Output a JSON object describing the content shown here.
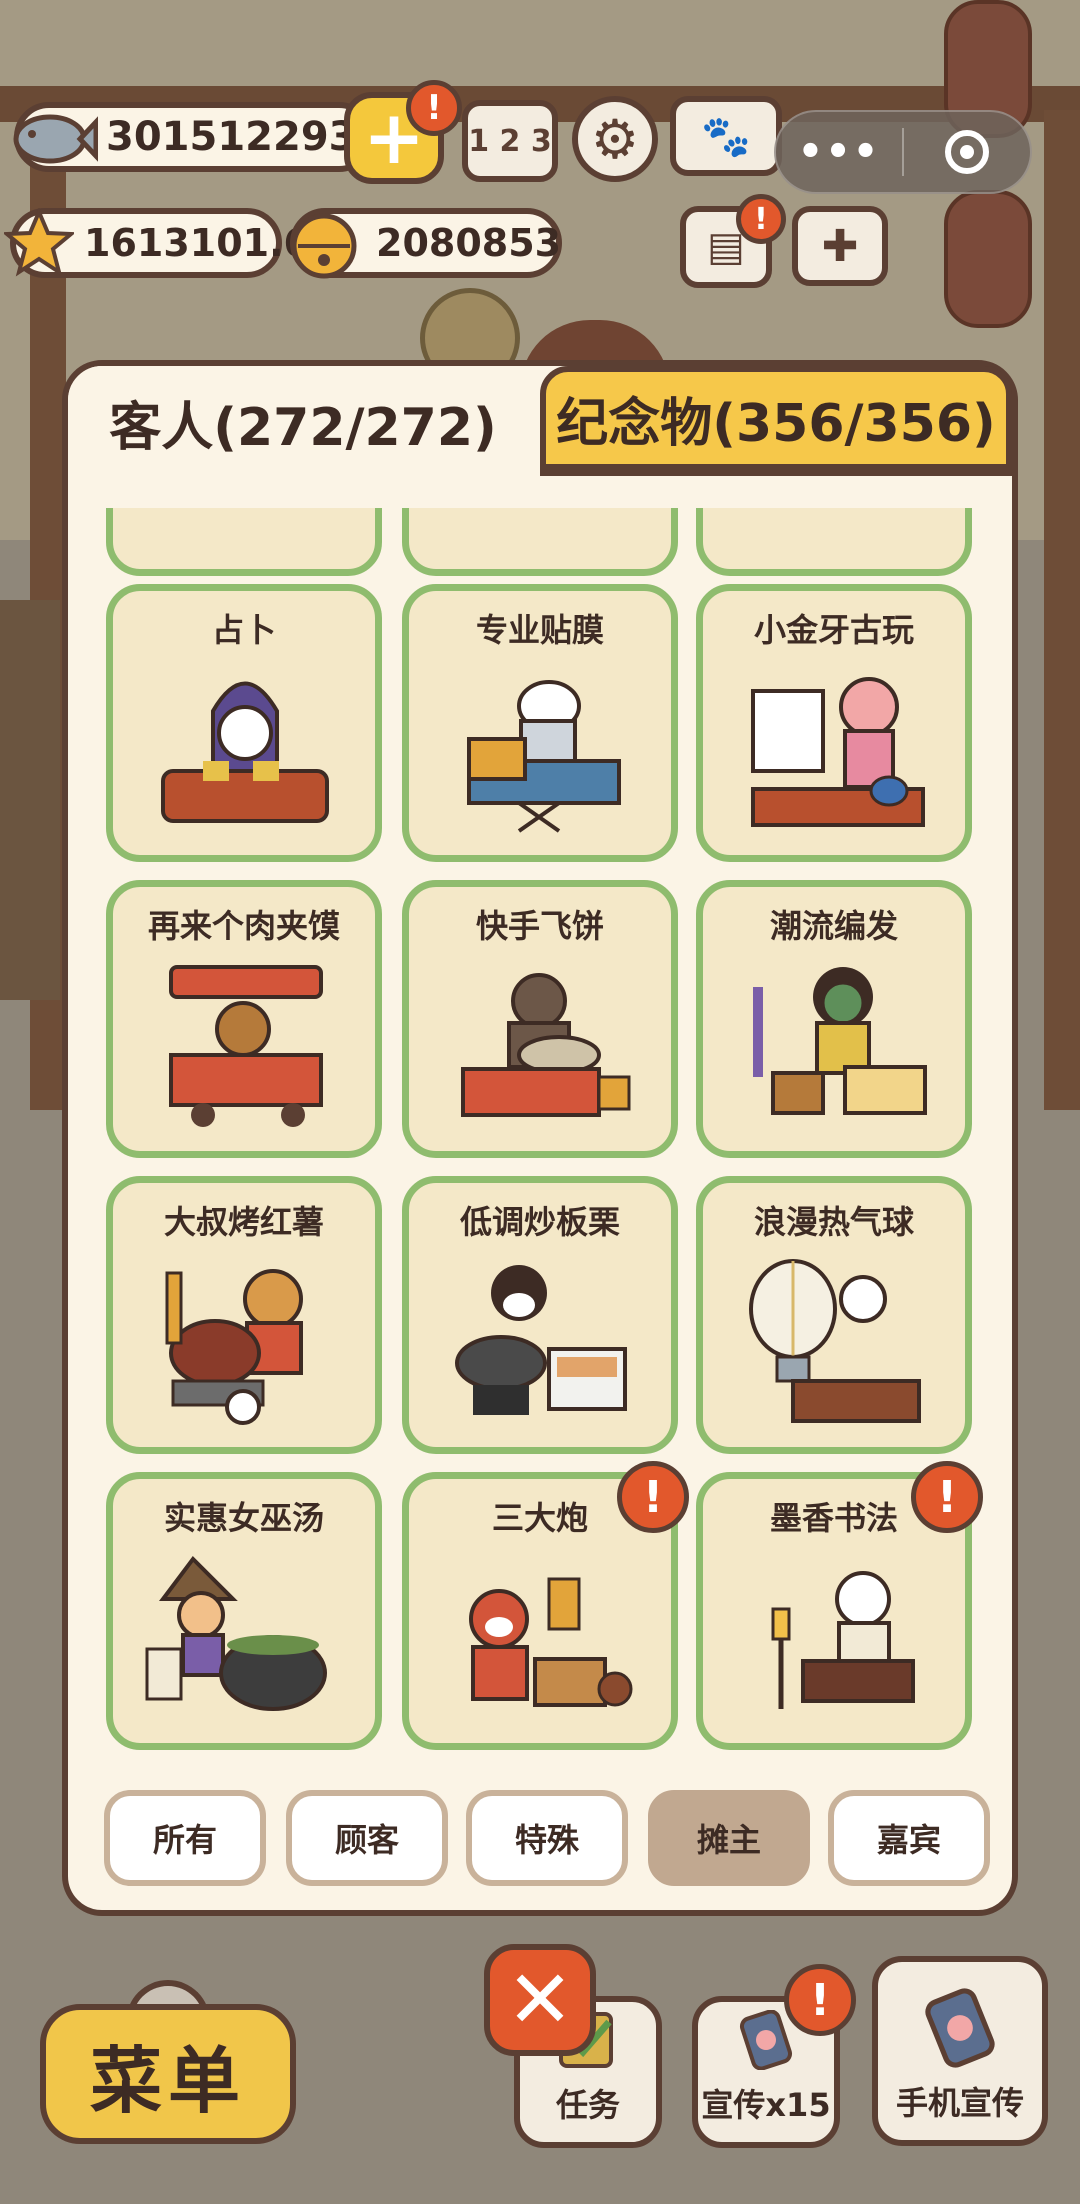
{
  "hud": {
    "fish_count": "3015122931",
    "star_count": "1613101.6",
    "bell_count": "2080853",
    "plus_alert": "!",
    "news_alert": "!",
    "rank_label": "1 2 3",
    "capsule_dots": "•••"
  },
  "tabs": {
    "guests": "客人(272/272)",
    "souvenirs": "纪念物(356/356)"
  },
  "cards": [
    {
      "name": "占卜",
      "alert": ""
    },
    {
      "name": "专业贴膜",
      "alert": ""
    },
    {
      "name": "小金牙古玩",
      "alert": ""
    },
    {
      "name": "再来个肉夹馍",
      "alert": ""
    },
    {
      "name": "快手飞饼",
      "alert": ""
    },
    {
      "name": "潮流编发",
      "alert": ""
    },
    {
      "name": "大叔烤红薯",
      "alert": ""
    },
    {
      "name": "低调炒板栗",
      "alert": ""
    },
    {
      "name": "浪漫热气球",
      "alert": ""
    },
    {
      "name": "实惠女巫汤",
      "alert": ""
    },
    {
      "name": "三大炮",
      "alert": "!"
    },
    {
      "name": "墨香书法",
      "alert": "!"
    }
  ],
  "filters": {
    "all": "所有",
    "customers": "顾客",
    "special": "特殊",
    "stall_owners": "摊主",
    "guests": "嘉宾",
    "active": "摊主"
  },
  "bottom": {
    "menu": "菜单",
    "close": "✕",
    "tasks": "任务",
    "promo": "宣传x15",
    "promo_alert": "!",
    "phone_promo": "手机宣传"
  },
  "colors": {
    "panel": "#fbf4e6",
    "card": "#f4e8c8",
    "card_border": "#8fbc6e",
    "tab_active": "#f6c84a",
    "alert": "#e2582c",
    "outline": "#5b3f33"
  }
}
